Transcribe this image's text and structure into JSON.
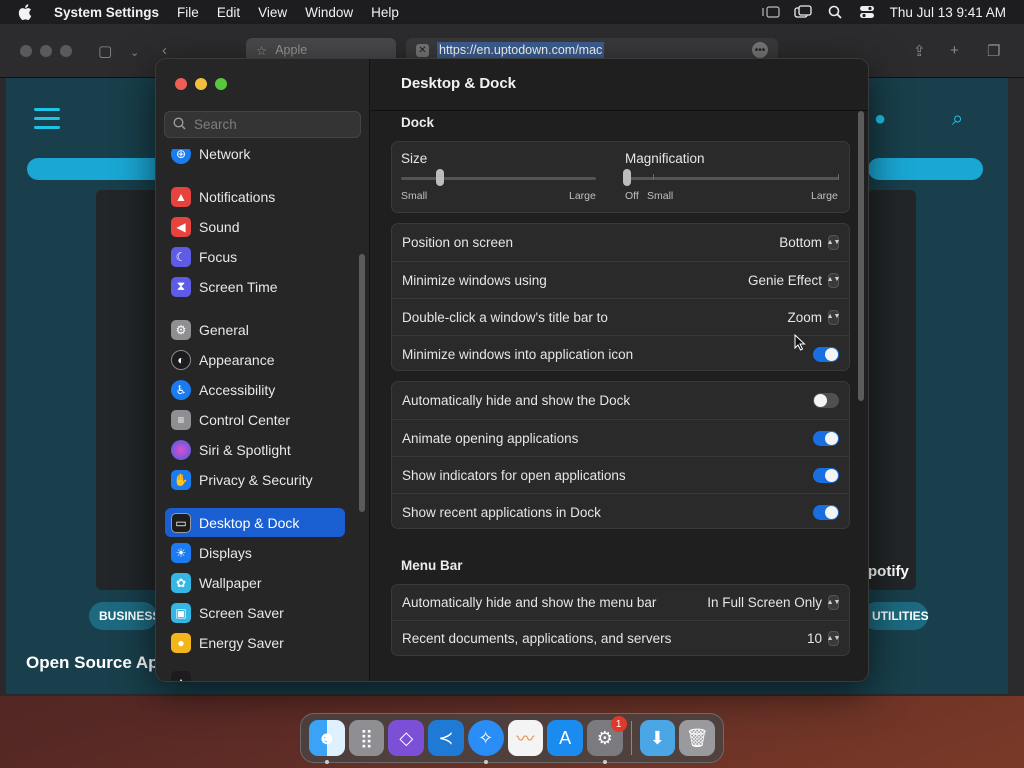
{
  "menubar": {
    "app_name": "System Settings",
    "items": [
      "File",
      "Edit",
      "View",
      "Window",
      "Help"
    ],
    "clock": "Thu Jul 13  9:41 AM"
  },
  "browser": {
    "tabs": [
      {
        "label": "Apple"
      },
      {
        "label": "https://en.uptodown.com/mac"
      }
    ],
    "page": {
      "chips": [
        "BUSINESS",
        "UTILITIES"
      ],
      "headline": "Open Source Ap",
      "tile_text": "potify"
    }
  },
  "search": {
    "placeholder": "Search"
  },
  "sidebar": {
    "items": [
      {
        "label": "Network",
        "icon": "network-icon",
        "color": "#1a7cf0"
      },
      {
        "label": "Notifications",
        "icon": "bell-icon",
        "color": "#e5433b"
      },
      {
        "label": "Sound",
        "icon": "speaker-icon",
        "color": "#e5433b"
      },
      {
        "label": "Focus",
        "icon": "moon-icon",
        "color": "#5e5ce6"
      },
      {
        "label": "Screen Time",
        "icon": "hourglass-icon",
        "color": "#5e5ce6"
      },
      {
        "label": "General",
        "icon": "gear-icon",
        "color": "#8e8e93"
      },
      {
        "label": "Appearance",
        "icon": "appearance-icon",
        "color": "#1c1c1e"
      },
      {
        "label": "Accessibility",
        "icon": "accessibility-icon",
        "color": "#1a7cf0"
      },
      {
        "label": "Control Center",
        "icon": "toggles-icon",
        "color": "#8e8e93"
      },
      {
        "label": "Siri & Spotlight",
        "icon": "siri-icon",
        "color": "#b03cd0"
      },
      {
        "label": "Privacy & Security",
        "icon": "hand-icon",
        "color": "#1a7cf0"
      },
      {
        "label": "Desktop & Dock",
        "icon": "dock-icon",
        "color": "#1c1c1e",
        "selected": true
      },
      {
        "label": "Displays",
        "icon": "sun-icon",
        "color": "#1a7cf0"
      },
      {
        "label": "Wallpaper",
        "icon": "flower-icon",
        "color": "#35b7e6"
      },
      {
        "label": "Screen Saver",
        "icon": "screensaver-icon",
        "color": "#35b7e6"
      },
      {
        "label": "Energy Saver",
        "icon": "bulb-icon",
        "color": "#f2b61b"
      }
    ]
  },
  "content": {
    "title": "Desktop & Dock",
    "dock_section": "Dock",
    "size": {
      "label": "Size",
      "min": "Small",
      "max": "Large",
      "value": 0.2
    },
    "magnification": {
      "label": "Magnification",
      "off": "Off",
      "min": "Small",
      "max": "Large",
      "value": 0.0
    },
    "rows": [
      {
        "label": "Position on screen",
        "value": "Bottom",
        "control": "popup"
      },
      {
        "label": "Minimize windows using",
        "value": "Genie Effect",
        "control": "popup"
      },
      {
        "label": "Double-click a window's title bar to",
        "value": "Zoom",
        "control": "popup"
      },
      {
        "label": "Minimize windows into application icon",
        "control": "toggle",
        "on": true
      }
    ],
    "rows2": [
      {
        "label": "Automatically hide and show the Dock",
        "control": "toggle",
        "on": false
      },
      {
        "label": "Animate opening applications",
        "control": "toggle",
        "on": true
      },
      {
        "label": "Show indicators for open applications",
        "control": "toggle",
        "on": true
      },
      {
        "label": "Show recent applications in Dock",
        "control": "toggle",
        "on": true
      }
    ],
    "menubar_section": "Menu Bar",
    "rows3": [
      {
        "label": "Automatically hide and show the menu bar",
        "value": "In Full Screen Only",
        "control": "popup"
      },
      {
        "label": "Recent documents, applications, and servers",
        "value": "10",
        "control": "popup"
      }
    ]
  },
  "dock": {
    "apps": [
      {
        "name": "finder-icon",
        "color": "#2f8ef0",
        "running": true
      },
      {
        "name": "launchpad-icon",
        "color": "#8e8e93",
        "running": false
      },
      {
        "name": "visual-studio-icon",
        "color": "#7b4fd6",
        "running": false
      },
      {
        "name": "vscode-icon",
        "color": "#1f7ad6",
        "running": false
      },
      {
        "name": "safari-icon",
        "color": "#2a8cf5",
        "running": true
      },
      {
        "name": "freeform-icon",
        "color": "#f4f4f4",
        "running": false
      },
      {
        "name": "app-store-icon",
        "color": "#1a8cf0",
        "running": false
      },
      {
        "name": "system-settings-icon",
        "color": "#7a7a7f",
        "running": true,
        "badge": "1"
      }
    ],
    "extras": [
      {
        "name": "downloads-folder-icon",
        "color": "#4ba6e6"
      },
      {
        "name": "trash-icon",
        "color": "#9a9a9e"
      }
    ]
  }
}
